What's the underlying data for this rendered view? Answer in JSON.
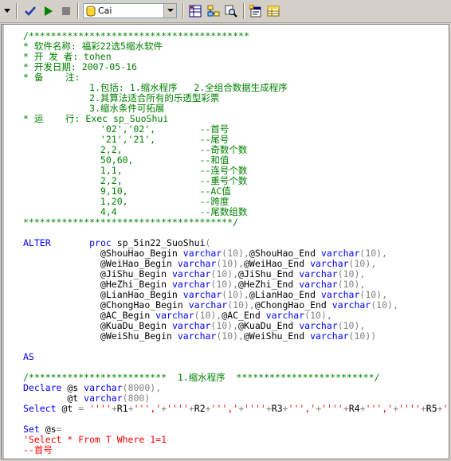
{
  "toolbar": {
    "database": "Cai"
  },
  "code_lines": [
    [
      [
        "/****************************************",
        "green"
      ]
    ],
    [
      [
        "* 软件名称: 福彩22选5缩水软件",
        "green"
      ]
    ],
    [
      [
        "* 开 发 者: tohen",
        "green"
      ]
    ],
    [
      [
        "* 开发日期: 2007-05-16",
        "green"
      ]
    ],
    [
      [
        "* 备    注:",
        "green"
      ]
    ],
    [
      [
        "            1.包括: 1.缩水程序   2.全组合数据生成程序",
        "green"
      ]
    ],
    [
      [
        "            2.其算法适合所有的乐透型彩票",
        "green"
      ]
    ],
    [
      [
        "            3.缩水条件可拓展",
        "green"
      ]
    ],
    [
      [
        "* 运    行: Exec sp_SuoShui",
        "green"
      ]
    ],
    [
      [
        "              '02','02',        --首号",
        "green"
      ]
    ],
    [
      [
        "              '21','21',        --尾号",
        "green"
      ]
    ],
    [
      [
        "              2,2,              --奇数个数",
        "green"
      ]
    ],
    [
      [
        "              50,60,            --和值",
        "green"
      ]
    ],
    [
      [
        "              1,1,              --连号个数",
        "green"
      ]
    ],
    [
      [
        "              2,2,              --重号个数",
        "green"
      ]
    ],
    [
      [
        "              9,10,             --AC值",
        "green"
      ]
    ],
    [
      [
        "              1,20,             --跨度",
        "green"
      ]
    ],
    [
      [
        "              4,4               --尾数组数",
        "green"
      ]
    ],
    [
      [
        "**************************************/",
        "green"
      ]
    ],
    [
      [
        "",
        "black"
      ]
    ],
    [
      [
        "ALTER",
        "blue"
      ],
      [
        "       ",
        "black"
      ],
      [
        "proc",
        "blue"
      ],
      [
        " sp_5in22_SuoShui",
        "black"
      ],
      [
        "(",
        "gray"
      ]
    ],
    [
      [
        "              @ShouHao_Begin ",
        "black"
      ],
      [
        "varchar",
        "blue"
      ],
      [
        "(10)",
        "gray"
      ],
      [
        ",",
        "gray"
      ],
      [
        "@ShouHao_End ",
        "black"
      ],
      [
        "varchar",
        "blue"
      ],
      [
        "(10)",
        "gray"
      ],
      [
        ",",
        "gray"
      ]
    ],
    [
      [
        "              @WeiHao_Begin ",
        "black"
      ],
      [
        "varchar",
        "blue"
      ],
      [
        "(10)",
        "gray"
      ],
      [
        ",",
        "gray"
      ],
      [
        "@WeiHao_End ",
        "black"
      ],
      [
        "varchar",
        "blue"
      ],
      [
        "(10)",
        "gray"
      ],
      [
        ",",
        "gray"
      ]
    ],
    [
      [
        "              @JiShu_Begin ",
        "black"
      ],
      [
        "varchar",
        "blue"
      ],
      [
        "(10)",
        "gray"
      ],
      [
        ",",
        "gray"
      ],
      [
        "@JiShu_End ",
        "black"
      ],
      [
        "varchar",
        "blue"
      ],
      [
        "(10)",
        "gray"
      ],
      [
        ",",
        "gray"
      ]
    ],
    [
      [
        "              @HeZhi_Begin ",
        "black"
      ],
      [
        "varchar",
        "blue"
      ],
      [
        "(10)",
        "gray"
      ],
      [
        ",",
        "gray"
      ],
      [
        "@HeZhi_End ",
        "black"
      ],
      [
        "varchar",
        "blue"
      ],
      [
        "(10)",
        "gray"
      ],
      [
        ",",
        "gray"
      ]
    ],
    [
      [
        "              @LianHao_Begin ",
        "black"
      ],
      [
        "varchar",
        "blue"
      ],
      [
        "(10)",
        "gray"
      ],
      [
        ",",
        "gray"
      ],
      [
        "@LianHao_End ",
        "black"
      ],
      [
        "varchar",
        "blue"
      ],
      [
        "(10)",
        "gray"
      ],
      [
        ",",
        "gray"
      ]
    ],
    [
      [
        "              @ChongHao_Begin ",
        "black"
      ],
      [
        "varchar",
        "blue"
      ],
      [
        "(10)",
        "gray"
      ],
      [
        ",",
        "gray"
      ],
      [
        "@ChongHao_End ",
        "black"
      ],
      [
        "varchar",
        "blue"
      ],
      [
        "(10)",
        "gray"
      ],
      [
        ",",
        "gray"
      ]
    ],
    [
      [
        "              @AC_Begin ",
        "black"
      ],
      [
        "varchar",
        "blue"
      ],
      [
        "(10)",
        "gray"
      ],
      [
        ",",
        "gray"
      ],
      [
        "@AC_End ",
        "black"
      ],
      [
        "varchar",
        "blue"
      ],
      [
        "(10)",
        "gray"
      ],
      [
        ",",
        "gray"
      ]
    ],
    [
      [
        "              @KuaDu_Begin ",
        "black"
      ],
      [
        "varchar",
        "blue"
      ],
      [
        "(10)",
        "gray"
      ],
      [
        ",",
        "gray"
      ],
      [
        "@KuaDu_End ",
        "black"
      ],
      [
        "varchar",
        "blue"
      ],
      [
        "(10)",
        "gray"
      ],
      [
        ",",
        "gray"
      ]
    ],
    [
      [
        "              @WeiShu_Begin ",
        "black"
      ],
      [
        "varchar",
        "blue"
      ],
      [
        "(10)",
        "gray"
      ],
      [
        ",",
        "gray"
      ],
      [
        "@WeiShu_End ",
        "black"
      ],
      [
        "varchar",
        "blue"
      ],
      [
        "(10)",
        "gray"
      ],
      [
        ")",
        "gray"
      ]
    ],
    [
      [
        "",
        "black"
      ]
    ],
    [
      [
        "AS",
        "blue"
      ]
    ],
    [
      [
        "",
        "black"
      ]
    ],
    [
      [
        "/*************************  1.缩水程序  *************************/",
        "green"
      ]
    ],
    [
      [
        "Declare",
        "blue"
      ],
      [
        " @s ",
        "black"
      ],
      [
        "varchar",
        "blue"
      ],
      [
        "(8000)",
        "gray"
      ],
      [
        ",",
        "gray"
      ]
    ],
    [
      [
        "        @t ",
        "black"
      ],
      [
        "varchar",
        "blue"
      ],
      [
        "(800)",
        "gray"
      ]
    ],
    [
      [
        "Select",
        "blue"
      ],
      [
        " @t ",
        "black"
      ],
      [
        "=",
        "gray"
      ],
      [
        " ",
        "black"
      ],
      [
        "''''",
        "red"
      ],
      [
        "+",
        "gray"
      ],
      [
        "R1",
        "black"
      ],
      [
        "+",
        "gray"
      ],
      [
        "''','",
        "red"
      ],
      [
        "+",
        "gray"
      ],
      [
        "''''",
        "red"
      ],
      [
        "+",
        "gray"
      ],
      [
        "R2",
        "black"
      ],
      [
        "+",
        "gray"
      ],
      [
        "''','",
        "red"
      ],
      [
        "+",
        "gray"
      ],
      [
        "''''",
        "red"
      ],
      [
        "+",
        "gray"
      ],
      [
        "R3",
        "black"
      ],
      [
        "+",
        "gray"
      ],
      [
        "''','",
        "red"
      ],
      [
        "+",
        "gray"
      ],
      [
        "''''",
        "red"
      ],
      [
        "+",
        "gray"
      ],
      [
        "R4",
        "black"
      ],
      [
        "+",
        "gray"
      ],
      [
        "''','",
        "red"
      ],
      [
        "+",
        "gray"
      ],
      [
        "''''",
        "red"
      ],
      [
        "+",
        "gray"
      ],
      [
        "R5",
        "black"
      ],
      [
        "+",
        "gray"
      ],
      [
        "'''",
        "red"
      ]
    ],
    [
      [
        "",
        "black"
      ]
    ],
    [
      [
        "Set",
        "blue"
      ],
      [
        " @s",
        "black"
      ],
      [
        "=",
        "gray"
      ]
    ],
    [
      [
        "'Select * From T Where 1=1",
        "red"
      ]
    ],
    [
      [
        "--首号",
        "red"
      ]
    ],
    [
      [
        "--...",
        "red"
      ]
    ]
  ]
}
